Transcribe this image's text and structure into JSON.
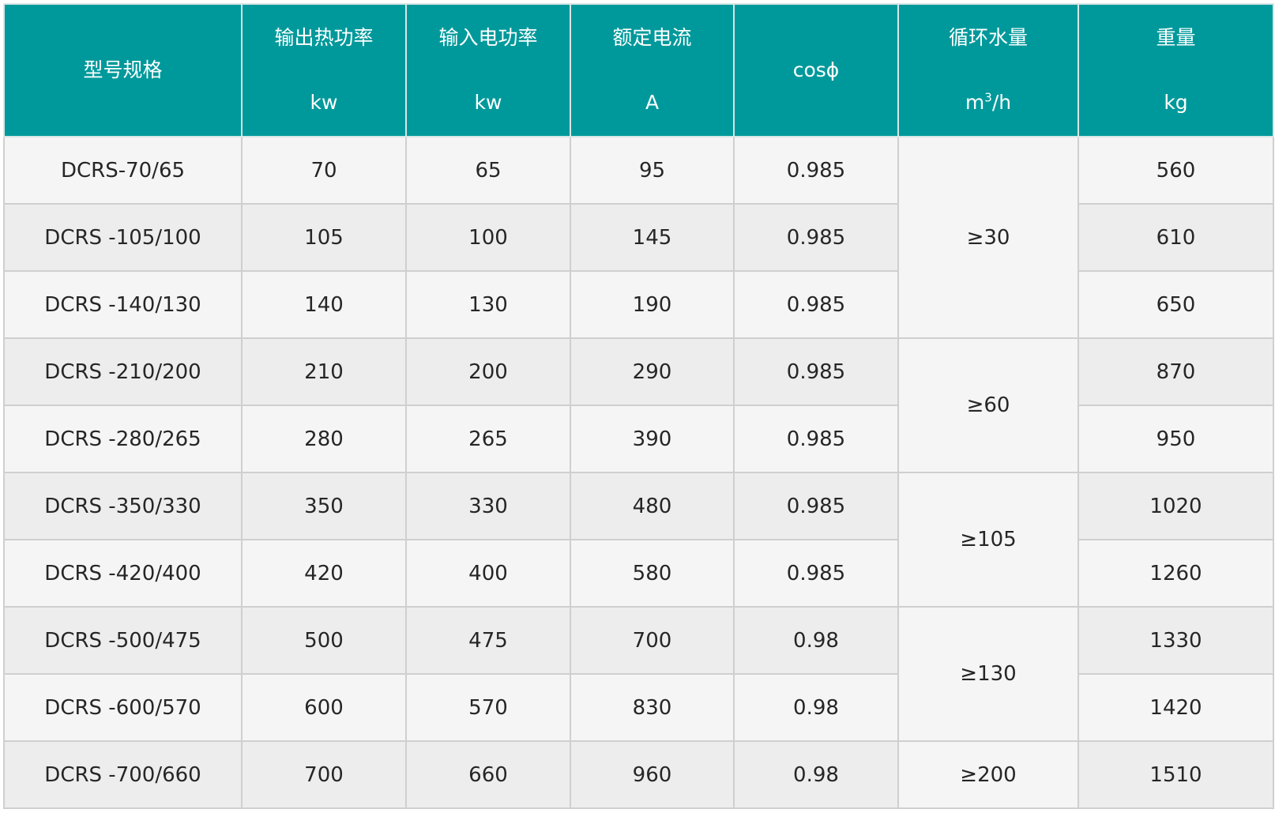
{
  "table": {
    "headers": [
      {
        "name": "型号规格",
        "unit": ""
      },
      {
        "name": "输出热功率",
        "unit": "kw"
      },
      {
        "name": "输入电功率",
        "unit": "kw"
      },
      {
        "name": "额定电流",
        "unit": "A"
      },
      {
        "name": "cosϕ",
        "unit": ""
      },
      {
        "name": "循环水量",
        "unit_base": "m",
        "unit_sup": "3",
        "unit_tail": "/h"
      },
      {
        "name": "重量",
        "unit": "kg"
      }
    ],
    "rows": [
      {
        "model": "DCRS-70/65",
        "output": "70",
        "input": "65",
        "current": "95",
        "cos": "0.985",
        "weight": "560"
      },
      {
        "model": "DCRS -105/100",
        "output": "105",
        "input": "100",
        "current": "145",
        "cos": "0.985",
        "weight": "610"
      },
      {
        "model": "DCRS -140/130",
        "output": "140",
        "input": "130",
        "current": "190",
        "cos": "0.985",
        "weight": "650"
      },
      {
        "model": "DCRS -210/200",
        "output": "210",
        "input": "200",
        "current": "290",
        "cos": "0.985",
        "weight": "870"
      },
      {
        "model": "DCRS -280/265",
        "output": "280",
        "input": "265",
        "current": "390",
        "cos": "0.985",
        "weight": "950"
      },
      {
        "model": "DCRS -350/330",
        "output": "350",
        "input": "330",
        "current": "480",
        "cos": "0.985",
        "weight": "1020"
      },
      {
        "model": "DCRS -420/400",
        "output": "420",
        "input": "400",
        "current": "580",
        "cos": "0.985",
        "weight": "1260"
      },
      {
        "model": "DCRS -500/475",
        "output": "500",
        "input": "475",
        "current": "700",
        "cos": "0.98",
        "weight": "1330"
      },
      {
        "model": "DCRS -600/570",
        "output": "600",
        "input": "570",
        "current": "830",
        "cos": "0.98",
        "weight": "1420"
      },
      {
        "model": "DCRS -700/660",
        "output": "700",
        "input": "660",
        "current": "960",
        "cos": "0.98",
        "weight": "1510"
      }
    ],
    "water_groups": [
      {
        "value": "≥30"
      },
      {
        "value": "≥60"
      },
      {
        "value": "≥105"
      },
      {
        "value": "≥130"
      },
      {
        "value": "≥200"
      }
    ]
  }
}
